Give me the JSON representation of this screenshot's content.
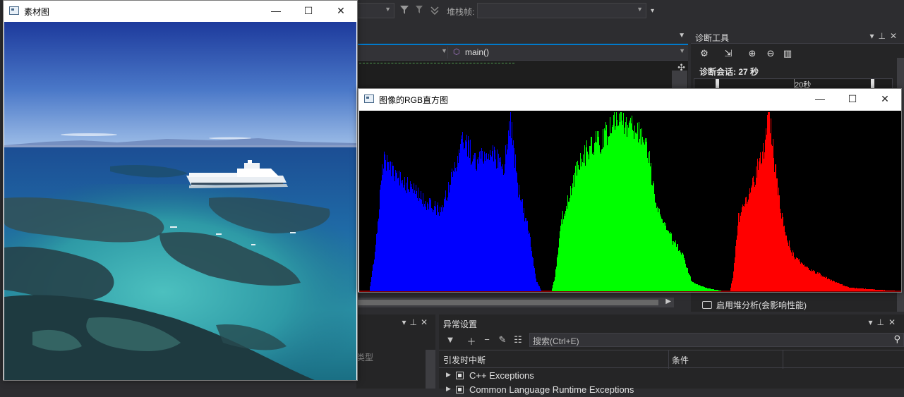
{
  "ide": {
    "toolbar": {
      "stack_frame_label": "堆栈帧:"
    },
    "editor": {
      "function_nav": "main()"
    },
    "diagnostics": {
      "title": "诊断工具",
      "session": "诊断会话: 27 秒",
      "timeline_label": "20秒",
      "heap_profiling": "启用堆分析(会影响性能)"
    },
    "left_pane": {
      "type_column_label": "类型"
    },
    "exceptions": {
      "title": "异常设置",
      "search_placeholder": "搜索(Ctrl+E)",
      "col_break": "引发时中断",
      "col_condition": "条件",
      "rows": [
        {
          "label": "C++ Exceptions"
        },
        {
          "label": "Common Language Runtime Exceptions"
        }
      ]
    }
  },
  "windows": {
    "photo": {
      "title": "素材图"
    },
    "histogram": {
      "title": "图像的RGB直方图",
      "colors": {
        "blue": "#0000ff",
        "green": "#00ff00",
        "red": "#ff0000",
        "background": "#000000"
      }
    }
  },
  "icons": {
    "window_minimize": "minimize-icon",
    "window_maximize": "maximize-icon",
    "window_close": "close-icon",
    "filter": "filter-icon",
    "settings": "gear-icon",
    "search": "search-icon"
  }
}
